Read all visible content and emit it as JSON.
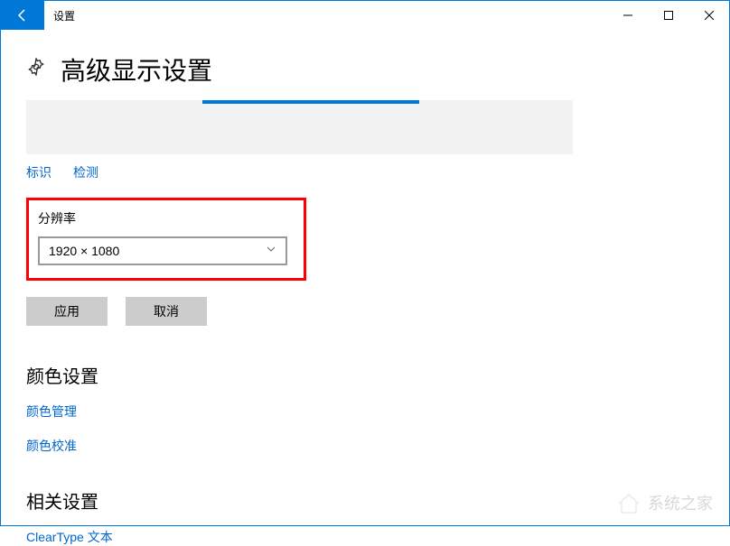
{
  "window": {
    "title": "设置"
  },
  "page": {
    "title": "高级显示设置"
  },
  "links": {
    "identify": "标识",
    "detect": "检测"
  },
  "resolution": {
    "label": "分辨率",
    "value": "1920 × 1080"
  },
  "buttons": {
    "apply": "应用",
    "cancel": "取消"
  },
  "sections": {
    "color": {
      "title": "颜色设置",
      "links": {
        "color_management": "颜色管理",
        "color_calibration": "颜色校准"
      }
    },
    "related": {
      "title": "相关设置",
      "links": {
        "cleartype": "ClearType 文本"
      }
    }
  },
  "watermark": "系统之家"
}
